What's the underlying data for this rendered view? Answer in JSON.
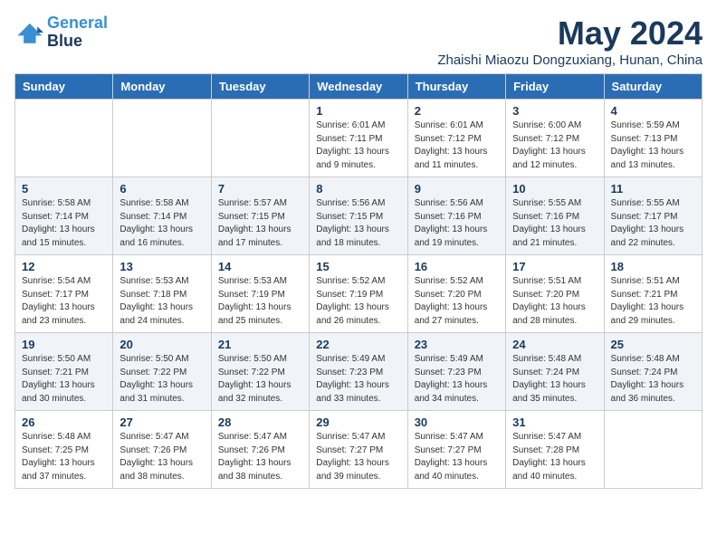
{
  "logo": {
    "line1": "General",
    "line2": "Blue"
  },
  "title": "May 2024",
  "location": "Zhaishi Miaozu Dongzuxiang, Hunan, China",
  "days_of_week": [
    "Sunday",
    "Monday",
    "Tuesday",
    "Wednesday",
    "Thursday",
    "Friday",
    "Saturday"
  ],
  "weeks": [
    [
      {
        "day": "",
        "info": ""
      },
      {
        "day": "",
        "info": ""
      },
      {
        "day": "",
        "info": ""
      },
      {
        "day": "1",
        "info": "Sunrise: 6:01 AM\nSunset: 7:11 PM\nDaylight: 13 hours\nand 9 minutes."
      },
      {
        "day": "2",
        "info": "Sunrise: 6:01 AM\nSunset: 7:12 PM\nDaylight: 13 hours\nand 11 minutes."
      },
      {
        "day": "3",
        "info": "Sunrise: 6:00 AM\nSunset: 7:12 PM\nDaylight: 13 hours\nand 12 minutes."
      },
      {
        "day": "4",
        "info": "Sunrise: 5:59 AM\nSunset: 7:13 PM\nDaylight: 13 hours\nand 13 minutes."
      }
    ],
    [
      {
        "day": "5",
        "info": "Sunrise: 5:58 AM\nSunset: 7:14 PM\nDaylight: 13 hours\nand 15 minutes."
      },
      {
        "day": "6",
        "info": "Sunrise: 5:58 AM\nSunset: 7:14 PM\nDaylight: 13 hours\nand 16 minutes."
      },
      {
        "day": "7",
        "info": "Sunrise: 5:57 AM\nSunset: 7:15 PM\nDaylight: 13 hours\nand 17 minutes."
      },
      {
        "day": "8",
        "info": "Sunrise: 5:56 AM\nSunset: 7:15 PM\nDaylight: 13 hours\nand 18 minutes."
      },
      {
        "day": "9",
        "info": "Sunrise: 5:56 AM\nSunset: 7:16 PM\nDaylight: 13 hours\nand 19 minutes."
      },
      {
        "day": "10",
        "info": "Sunrise: 5:55 AM\nSunset: 7:16 PM\nDaylight: 13 hours\nand 21 minutes."
      },
      {
        "day": "11",
        "info": "Sunrise: 5:55 AM\nSunset: 7:17 PM\nDaylight: 13 hours\nand 22 minutes."
      }
    ],
    [
      {
        "day": "12",
        "info": "Sunrise: 5:54 AM\nSunset: 7:17 PM\nDaylight: 13 hours\nand 23 minutes."
      },
      {
        "day": "13",
        "info": "Sunrise: 5:53 AM\nSunset: 7:18 PM\nDaylight: 13 hours\nand 24 minutes."
      },
      {
        "day": "14",
        "info": "Sunrise: 5:53 AM\nSunset: 7:19 PM\nDaylight: 13 hours\nand 25 minutes."
      },
      {
        "day": "15",
        "info": "Sunrise: 5:52 AM\nSunset: 7:19 PM\nDaylight: 13 hours\nand 26 minutes."
      },
      {
        "day": "16",
        "info": "Sunrise: 5:52 AM\nSunset: 7:20 PM\nDaylight: 13 hours\nand 27 minutes."
      },
      {
        "day": "17",
        "info": "Sunrise: 5:51 AM\nSunset: 7:20 PM\nDaylight: 13 hours\nand 28 minutes."
      },
      {
        "day": "18",
        "info": "Sunrise: 5:51 AM\nSunset: 7:21 PM\nDaylight: 13 hours\nand 29 minutes."
      }
    ],
    [
      {
        "day": "19",
        "info": "Sunrise: 5:50 AM\nSunset: 7:21 PM\nDaylight: 13 hours\nand 30 minutes."
      },
      {
        "day": "20",
        "info": "Sunrise: 5:50 AM\nSunset: 7:22 PM\nDaylight: 13 hours\nand 31 minutes."
      },
      {
        "day": "21",
        "info": "Sunrise: 5:50 AM\nSunset: 7:22 PM\nDaylight: 13 hours\nand 32 minutes."
      },
      {
        "day": "22",
        "info": "Sunrise: 5:49 AM\nSunset: 7:23 PM\nDaylight: 13 hours\nand 33 minutes."
      },
      {
        "day": "23",
        "info": "Sunrise: 5:49 AM\nSunset: 7:23 PM\nDaylight: 13 hours\nand 34 minutes."
      },
      {
        "day": "24",
        "info": "Sunrise: 5:48 AM\nSunset: 7:24 PM\nDaylight: 13 hours\nand 35 minutes."
      },
      {
        "day": "25",
        "info": "Sunrise: 5:48 AM\nSunset: 7:24 PM\nDaylight: 13 hours\nand 36 minutes."
      }
    ],
    [
      {
        "day": "26",
        "info": "Sunrise: 5:48 AM\nSunset: 7:25 PM\nDaylight: 13 hours\nand 37 minutes."
      },
      {
        "day": "27",
        "info": "Sunrise: 5:47 AM\nSunset: 7:26 PM\nDaylight: 13 hours\nand 38 minutes."
      },
      {
        "day": "28",
        "info": "Sunrise: 5:47 AM\nSunset: 7:26 PM\nDaylight: 13 hours\nand 38 minutes."
      },
      {
        "day": "29",
        "info": "Sunrise: 5:47 AM\nSunset: 7:27 PM\nDaylight: 13 hours\nand 39 minutes."
      },
      {
        "day": "30",
        "info": "Sunrise: 5:47 AM\nSunset: 7:27 PM\nDaylight: 13 hours\nand 40 minutes."
      },
      {
        "day": "31",
        "info": "Sunrise: 5:47 AM\nSunset: 7:28 PM\nDaylight: 13 hours\nand 40 minutes."
      },
      {
        "day": "",
        "info": ""
      }
    ]
  ]
}
